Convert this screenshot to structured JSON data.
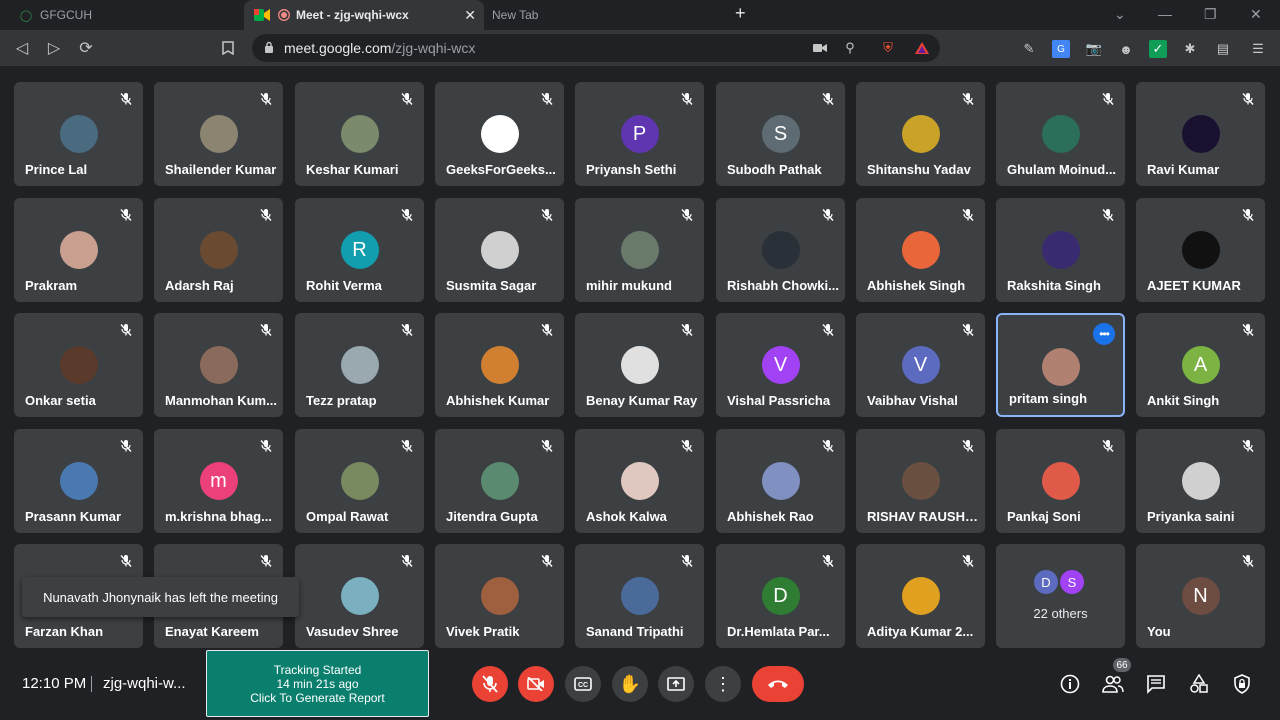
{
  "browser": {
    "tabs": [
      {
        "title": "GFGCUH"
      },
      {
        "title": "Meet - zjg-wqhi-wcx"
      },
      {
        "title": "New Tab"
      }
    ],
    "url_host": "meet.google.com",
    "url_path": "/zjg-wqhi-wcx"
  },
  "participants": [
    {
      "name": "Prince Lal",
      "color": "#4a6a80"
    },
    {
      "name": "Shailender Kumar",
      "color": "#8a8470"
    },
    {
      "name": "Keshar Kumari",
      "color": "#7a8a6a"
    },
    {
      "name": "GeeksForGeeks...",
      "color": "#ffffff"
    },
    {
      "name": "Priyansh Sethi",
      "initial": "P",
      "color": "#5f35b0"
    },
    {
      "name": "Subodh Pathak",
      "initial": "S",
      "color": "#5f6b73"
    },
    {
      "name": "Shitanshu Yadav",
      "color": "#c9a227"
    },
    {
      "name": "Ghulam Moinud...",
      "color": "#2b6e5a"
    },
    {
      "name": "Ravi Kumar",
      "color": "#1a1030"
    },
    {
      "name": "Prakram",
      "color": "#c9a090"
    },
    {
      "name": "Adarsh Raj",
      "color": "#6a4a30"
    },
    {
      "name": "Rohit Verma",
      "initial": "R",
      "color": "#129eaf"
    },
    {
      "name": "Susmita Sagar",
      "color": "#d0d0d0"
    },
    {
      "name": "mihir mukund",
      "color": "#6a7a6a"
    },
    {
      "name": "Rishabh Chowki...",
      "color": "#2a3038"
    },
    {
      "name": "Abhishek Singh",
      "color": "#e8663a"
    },
    {
      "name": "Rakshita Singh",
      "color": "#3a2a70"
    },
    {
      "name": "AJEET KUMAR",
      "color": "#111111"
    },
    {
      "name": "Onkar setia",
      "color": "#5a3a2a"
    },
    {
      "name": "Manmohan Kum...",
      "color": "#8a6a5a"
    },
    {
      "name": "Tezz pratap",
      "color": "#9aa8b0"
    },
    {
      "name": "Abhishek Kumar",
      "color": "#d08030"
    },
    {
      "name": "Benay Kumar Ray",
      "color": "#e0e0e0"
    },
    {
      "name": "Vishal Passricha",
      "initial": "V",
      "color": "#a142f4"
    },
    {
      "name": "Vaibhav Vishal",
      "initial": "V",
      "color": "#5c6bc0"
    },
    {
      "name": "pritam singh",
      "color": "#b08070",
      "selected": true
    },
    {
      "name": "Ankit Singh",
      "initial": "A",
      "color": "#7cb342"
    },
    {
      "name": "Prasann Kumar",
      "color": "#4a78b0"
    },
    {
      "name": "m.krishna bhag...",
      "initial": "m",
      "color": "#ec407a"
    },
    {
      "name": "Ompal Rawat",
      "color": "#7a8a60"
    },
    {
      "name": "Jitendra Gupta",
      "color": "#5a8a70"
    },
    {
      "name": "Ashok Kalwa",
      "color": "#e0c8c0"
    },
    {
      "name": "Abhishek Rao",
      "color": "#8090c0"
    },
    {
      "name": "RISHAV RAUSHAN",
      "color": "#6a5040"
    },
    {
      "name": "Pankaj Soni",
      "color": "#e05a4a"
    },
    {
      "name": "Priyanka saini",
      "color": "#d0d0d0"
    },
    {
      "name": "Farzan Khan",
      "color": "#6a6a6a"
    },
    {
      "name": "Enayat Kareem",
      "color": "#6a6a6a"
    },
    {
      "name": "Vasudev Shree",
      "color": "#7ab0c0"
    },
    {
      "name": "Vivek Pratik",
      "color": "#a06040"
    },
    {
      "name": "Sanand Tripathi",
      "color": "#4a6a9a"
    },
    {
      "name": "Dr.Hemlata Par...",
      "initial": "D",
      "color": "#2e7d32"
    },
    {
      "name": "Aditya Kumar 2...",
      "color": "#e0a020"
    },
    {
      "name": "22 others",
      "others": true
    },
    {
      "name": "You",
      "initial": "N",
      "color": "#6d4c41"
    }
  ],
  "others_initials": [
    "D",
    "S"
  ],
  "others_colors": [
    "#5c6bc0",
    "#a142f4"
  ],
  "toast": "Nunavath Jhonynaik has left the meeting",
  "bottom": {
    "time": "12:10 PM",
    "meeting_code": "zjg-wqhi-w...",
    "tracking_line1": "Tracking Started",
    "tracking_line2": "14 min 21s ago",
    "tracking_line3": "Click To Generate Report",
    "participants_count": "66"
  }
}
